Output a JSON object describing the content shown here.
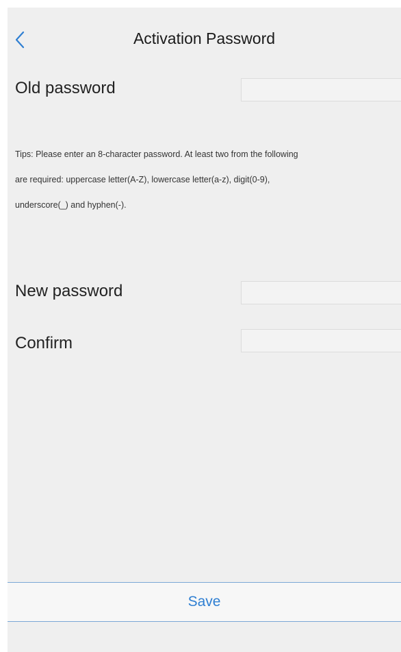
{
  "header": {
    "title": "Activation Password",
    "back_icon": "chevron-left-icon"
  },
  "form": {
    "old_password": {
      "label": "Old password",
      "value": ""
    },
    "tips": [
      "Tips: Please enter an 8-character password. At least two from the following",
      "are required: uppercase letter(A-Z), lowercase letter(a-z), digit(0-9),",
      "underscore(_) and hyphen(-)."
    ],
    "new_password": {
      "label": "New password",
      "value": ""
    },
    "confirm": {
      "label": "Confirm",
      "value": ""
    }
  },
  "footer": {
    "save_label": "Save"
  },
  "colors": {
    "accent": "#2f7fd2",
    "background": "#efefef",
    "divider": "#7ba7d6"
  }
}
